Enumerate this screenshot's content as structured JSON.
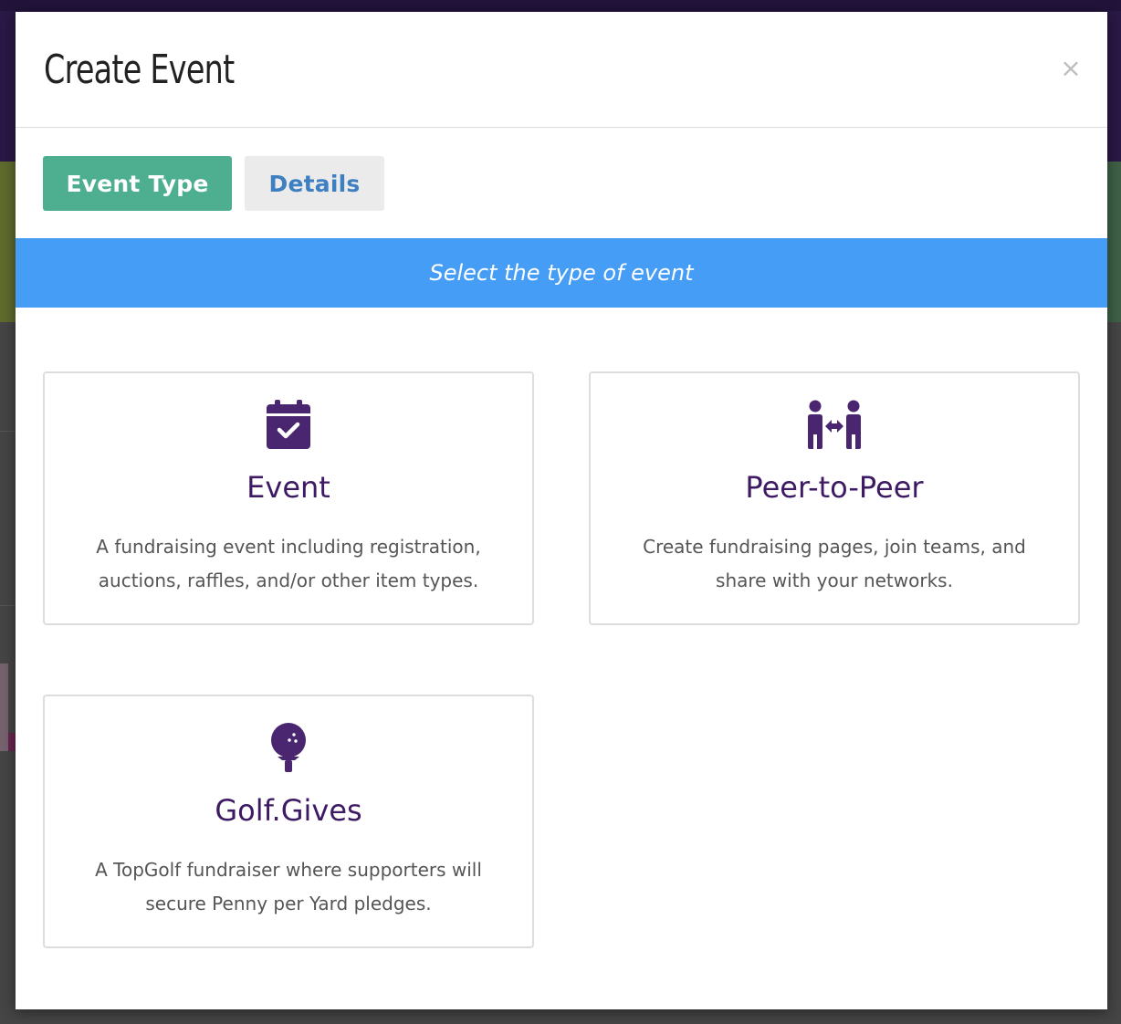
{
  "modal": {
    "title": "Create Event",
    "close_label": "×"
  },
  "tabs": [
    {
      "label": "Event Type",
      "active": true
    },
    {
      "label": "Details",
      "active": false
    }
  ],
  "banner": {
    "text": "Select the type of event"
  },
  "event_types": [
    {
      "icon": "calendar-check-icon",
      "title": "Event",
      "description": "A fundraising event including registration, auctions, raffles, and/or other item types."
    },
    {
      "icon": "people-arrows-icon",
      "title": "Peer-to-Peer",
      "description": "Create fundraising pages, join teams, and share with your networks."
    },
    {
      "icon": "golf-ball-tee-icon",
      "title": "Golf.Gives",
      "description": "A TopGolf fundraiser where supporters will secure Penny per Yard pledges."
    }
  ],
  "colors": {
    "tab_active_bg": "#4daf8f",
    "tab_inactive_text": "#3d7fc1",
    "banner_bg": "#459df6",
    "brand_purple": "#3d1a63",
    "icon_purple": "#4a2570"
  }
}
